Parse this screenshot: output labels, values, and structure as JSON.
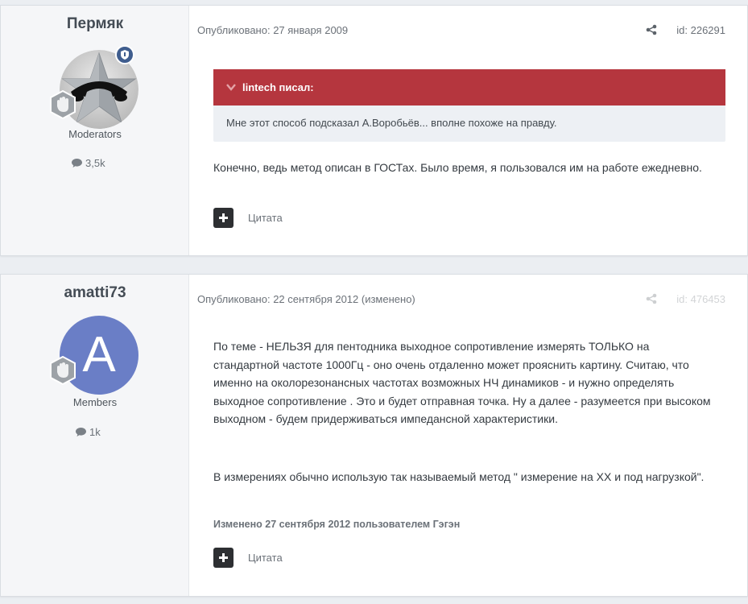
{
  "posts": [
    {
      "author": "Пермяк",
      "group": "Moderators",
      "post_count": "3,5k",
      "date_label": "Опубликовано: 27 января 2009",
      "id_label": "id: 226291",
      "quote": {
        "author_label": "lintech писал:",
        "text": "Мне этот способ подсказал А.Воробьёв... вполне похоже на правду."
      },
      "paragraphs": [
        "Конечно, ведь метод описан в ГОСТах. Было время, я пользовался им на работе ежедневно."
      ],
      "quote_button": "Цитата"
    },
    {
      "author": "amatti73",
      "avatar_letter": "A",
      "group": "Members",
      "post_count": "1k",
      "date_label": "Опубликовано: 22 сентября 2012 (изменено)",
      "id_label": "id: 476453",
      "paragraphs": [
        "По теме - НЕЛЬЗЯ для пентодника выходное сопротивление измерять ТОЛЬКО на стандартной частоте 1000Гц - оно очень отдаленно может прояснить картину. Считаю, что именно на околорезонансных частотах возможных НЧ динамиков - и нужно определять выходное сопротивление . Это и будет отправная точка. Ну а далее - разумеется при высоком выходном - будем придерживаться импедансной характеристики.",
        "В измерениях обычно использую так называемый метод \" измерение на ХХ и под нагрузкой\"."
      ],
      "edited_note": "Изменено 27 сентября 2012 пользователем Гэгэн",
      "quote_button": "Цитата"
    }
  ],
  "colors": {
    "quote_header": "#b5363e",
    "avatar_bg": "#6a7ec6",
    "badge_bg": "#3f5d8e"
  },
  "icons": {
    "share": "share-icon",
    "comment": "comment-icon",
    "plus": "plus-icon",
    "chevron": "chevron-down-icon",
    "shield": "shield-icon",
    "reputation": "hand-badge-icon"
  }
}
